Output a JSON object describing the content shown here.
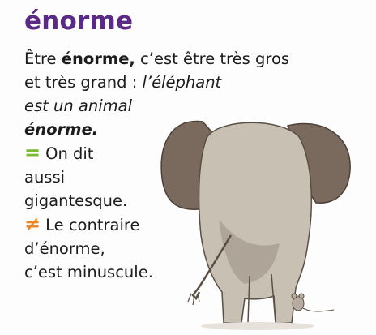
{
  "entry": {
    "headword": "énorme",
    "line1_pre": "Être ",
    "line1_bold": "énorme,",
    "line1_post": " c’est être très gros",
    "line2_pre": "et très grand : ",
    "line2_italic": "l’éléphant",
    "line3_italic": "est un animal",
    "line4_bold_italic": "énorme.",
    "synonym_symbol": "=",
    "synonym_line1": "On dit",
    "synonym_line2": "aussi",
    "synonym_line3": "gigantesque.",
    "antonym_symbol": "≠",
    "antonym_line1": "Le contraire",
    "antonym_line2": "d’énorme,",
    "antonym_line3": "c’est minuscule."
  },
  "colors": {
    "headword": "#5b2a86",
    "synonym_symbol": "#7ab92f",
    "antonym_symbol": "#e8882a"
  },
  "illustration": {
    "subject": "elephant-seen-from-behind-with-small-mouse"
  }
}
